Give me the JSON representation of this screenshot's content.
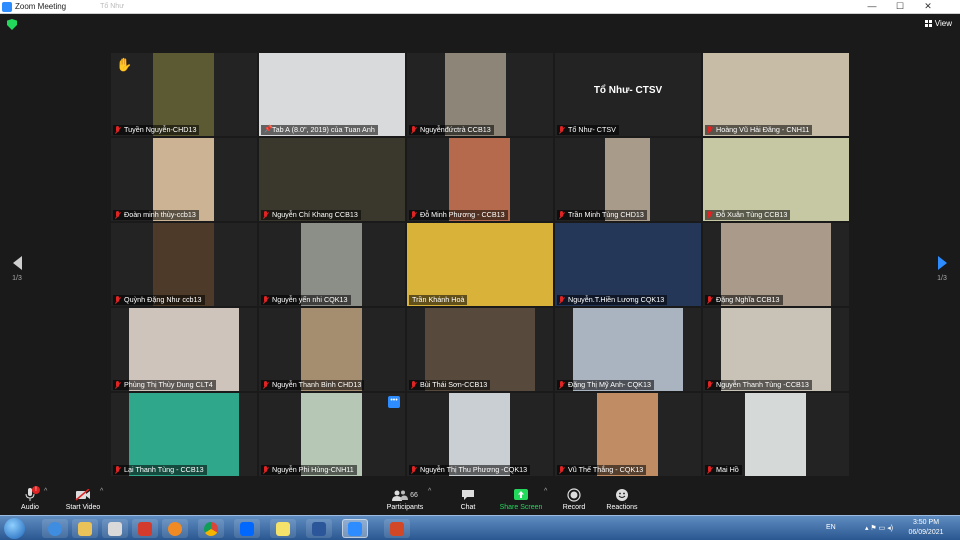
{
  "window": {
    "title": "Zoom Meeting",
    "ghost_title": "Tổ Như",
    "minimize": "—",
    "maximize": "☐",
    "close": "✕"
  },
  "view_label": "View",
  "overlay_text": "Tổ Như- CTSV",
  "pagination": {
    "left": "1/3",
    "right": "1/3"
  },
  "participants": [
    {
      "name": "Tuyền Nguyễn-CHD13",
      "bg": "#5c5a33",
      "icon": "muted-mic-icon"
    },
    {
      "name": "Tab A (8.0\", 2019) của Tuan Anh",
      "bg": "#d9dadc",
      "icon": "pin-icon"
    },
    {
      "name": "Nguyễnđứctrà CCB13",
      "bg": "#8d8577",
      "icon": "muted-mic-icon"
    },
    {
      "name": "Tổ Như- CTSV",
      "bg": "#232323",
      "icon": "muted-mic-icon"
    },
    {
      "name": "Hoàng Vũ Hải Đăng - CNH11",
      "bg": "#c7bda7",
      "icon": "muted-mic-icon"
    },
    {
      "name": "Đoàn minh thùy-ccb13",
      "bg": "#cbb393",
      "icon": "muted-mic-icon"
    },
    {
      "name": "Nguyễn Chí Khang CCB13",
      "bg": "#3a382c",
      "icon": "muted-mic-icon"
    },
    {
      "name": "Đỗ Minh Phương - CCB13",
      "bg": "#b56a4d",
      "icon": "muted-mic-icon"
    },
    {
      "name": "Trần Minh Tùng CHD13",
      "bg": "#a89b8a",
      "icon": "muted-mic-icon"
    },
    {
      "name": "Đỗ Xuân Tùng CCB13",
      "bg": "#c5c8a2",
      "icon": "muted-mic-icon"
    },
    {
      "name": "Quỳnh Đặng Như ccb13",
      "bg": "#4e3a28",
      "icon": "muted-mic-icon"
    },
    {
      "name": "Nguyễn yến nhi CQK13",
      "bg": "#8c8f88",
      "icon": "muted-mic-icon"
    },
    {
      "name": "Trần Khánh Hoà",
      "bg": "#d9b23a",
      "icon": "none"
    },
    {
      "name": "Nguyễn.T.Hiền Lương CQK13",
      "bg": "#243759",
      "icon": "muted-mic-icon"
    },
    {
      "name": "Đặng Nghĩa CCB13",
      "bg": "#a99a8a",
      "icon": "muted-mic-icon"
    },
    {
      "name": "Phùng Thị Thùy Dung CLT4",
      "bg": "#cfc4bb",
      "icon": "muted-mic-icon"
    },
    {
      "name": "Nguyễn Thanh Bình CHD13",
      "bg": "#a58d6f",
      "icon": "muted-mic-icon"
    },
    {
      "name": "Bùi Thái Sơn-CCB13",
      "bg": "#574a3d",
      "icon": "muted-mic-icon"
    },
    {
      "name": "Đặng Thị Mỹ Anh- CQK13",
      "bg": "#aab4c0",
      "icon": "muted-mic-icon"
    },
    {
      "name": "Nguyễn Thanh Tùng -CCB13",
      "bg": "#c9c2b6",
      "icon": "muted-mic-icon"
    },
    {
      "name": "Lại Thanh Tùng - CCB13",
      "bg": "#2fa78b",
      "icon": "muted-mic-icon"
    },
    {
      "name": "Nguyễn Phi Hùng-CNH11",
      "bg": "#b7c7b6",
      "icon": "muted-mic-icon"
    },
    {
      "name": "Nguyễn Thị Thu Phương -CQK13",
      "bg": "#c9cfd3",
      "icon": "muted-mic-icon"
    },
    {
      "name": "Vũ Thế Thắng - CQK13",
      "bg": "#c08c64",
      "icon": "muted-mic-icon"
    },
    {
      "name": "Mai Hồ",
      "bg": "#d5d9d7",
      "icon": "muted-mic-icon"
    }
  ],
  "toolbar": {
    "audio": "Audio",
    "audio_badge": "!",
    "start_video": "Start Video",
    "participants": "Participants",
    "participants_count": "66",
    "chat": "Chat",
    "share_screen": "Share Screen",
    "record": "Record",
    "reactions": "Reactions",
    "chevron": "^"
  },
  "taskbar": {
    "language": "EN",
    "time": "3:50 PM",
    "date": "06/09/2021"
  },
  "colors": {
    "accent": "#2d8cff",
    "active_speaker": "#d6e65c",
    "muted": "#e02424",
    "share": "#23d95c"
  }
}
